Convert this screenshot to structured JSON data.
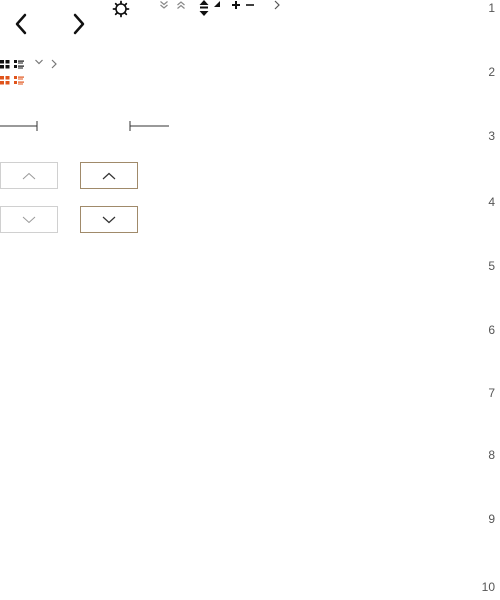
{
  "toolbar": {
    "icons": [
      "chevron-left-icon",
      "chevron-right-icon",
      "settings-gear-icon",
      "double-chevron-down-icon",
      "double-chevron-up-icon",
      "sort-icon",
      "corner-arrow-icon",
      "plus-icon",
      "minus-icon",
      "chevron-right-small-icon"
    ]
  },
  "view_toggles": {
    "icons": [
      "grid-view-icon",
      "list-view-icon",
      "chevron-down-icon",
      "chevron-right-icon"
    ],
    "active_color": "#e0541b"
  },
  "sliders": {
    "items": [
      "slider-left",
      "slider-right"
    ]
  },
  "steppers": {
    "neutral_border": "#d0d0d0",
    "accent_border": "#a08a6a"
  },
  "row_numbers": [
    "1",
    "2",
    "3",
    "4",
    "5",
    "6",
    "7",
    "8",
    "9",
    "10"
  ]
}
